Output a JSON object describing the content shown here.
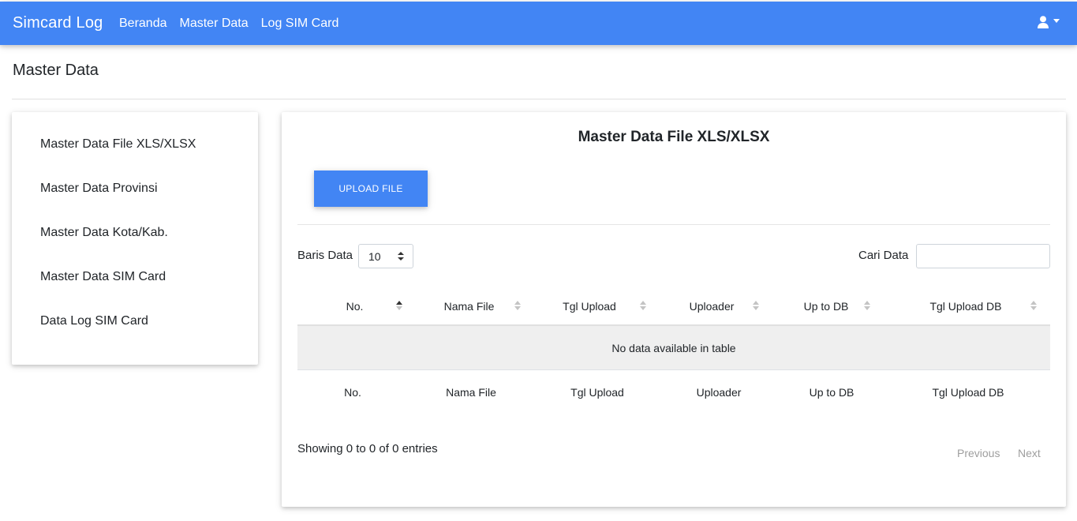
{
  "navbar": {
    "brand": "Simcard Log",
    "links": [
      "Beranda",
      "Master Data",
      "Log SIM Card"
    ],
    "user_icon": "user-icon"
  },
  "page": {
    "title": "Master Data"
  },
  "sidebar": {
    "items": [
      "Master Data File XLS/XLSX",
      "Master Data Provinsi",
      "Master Data Kota/Kab.",
      "Master Data SIM Card",
      "Data Log SIM Card"
    ]
  },
  "main": {
    "title": "Master Data File XLS/XLSX",
    "upload_label": "UPLOAD FILE",
    "length_label": "Baris Data",
    "length_value": "10",
    "search_label": "Cari Data",
    "search_value": "",
    "columns": [
      "No.",
      "Nama File",
      "Tgl Upload",
      "Uploader",
      "Up to DB",
      "Tgl Upload DB"
    ],
    "empty_message": "No data available in table",
    "info": "Showing 0 to 0 of 0 entries",
    "prev_label": "Previous",
    "next_label": "Next"
  },
  "colors": {
    "primary": "#4285f4",
    "row_empty_bg": "#efefef",
    "pager_disabled": "#9e9e9e"
  }
}
